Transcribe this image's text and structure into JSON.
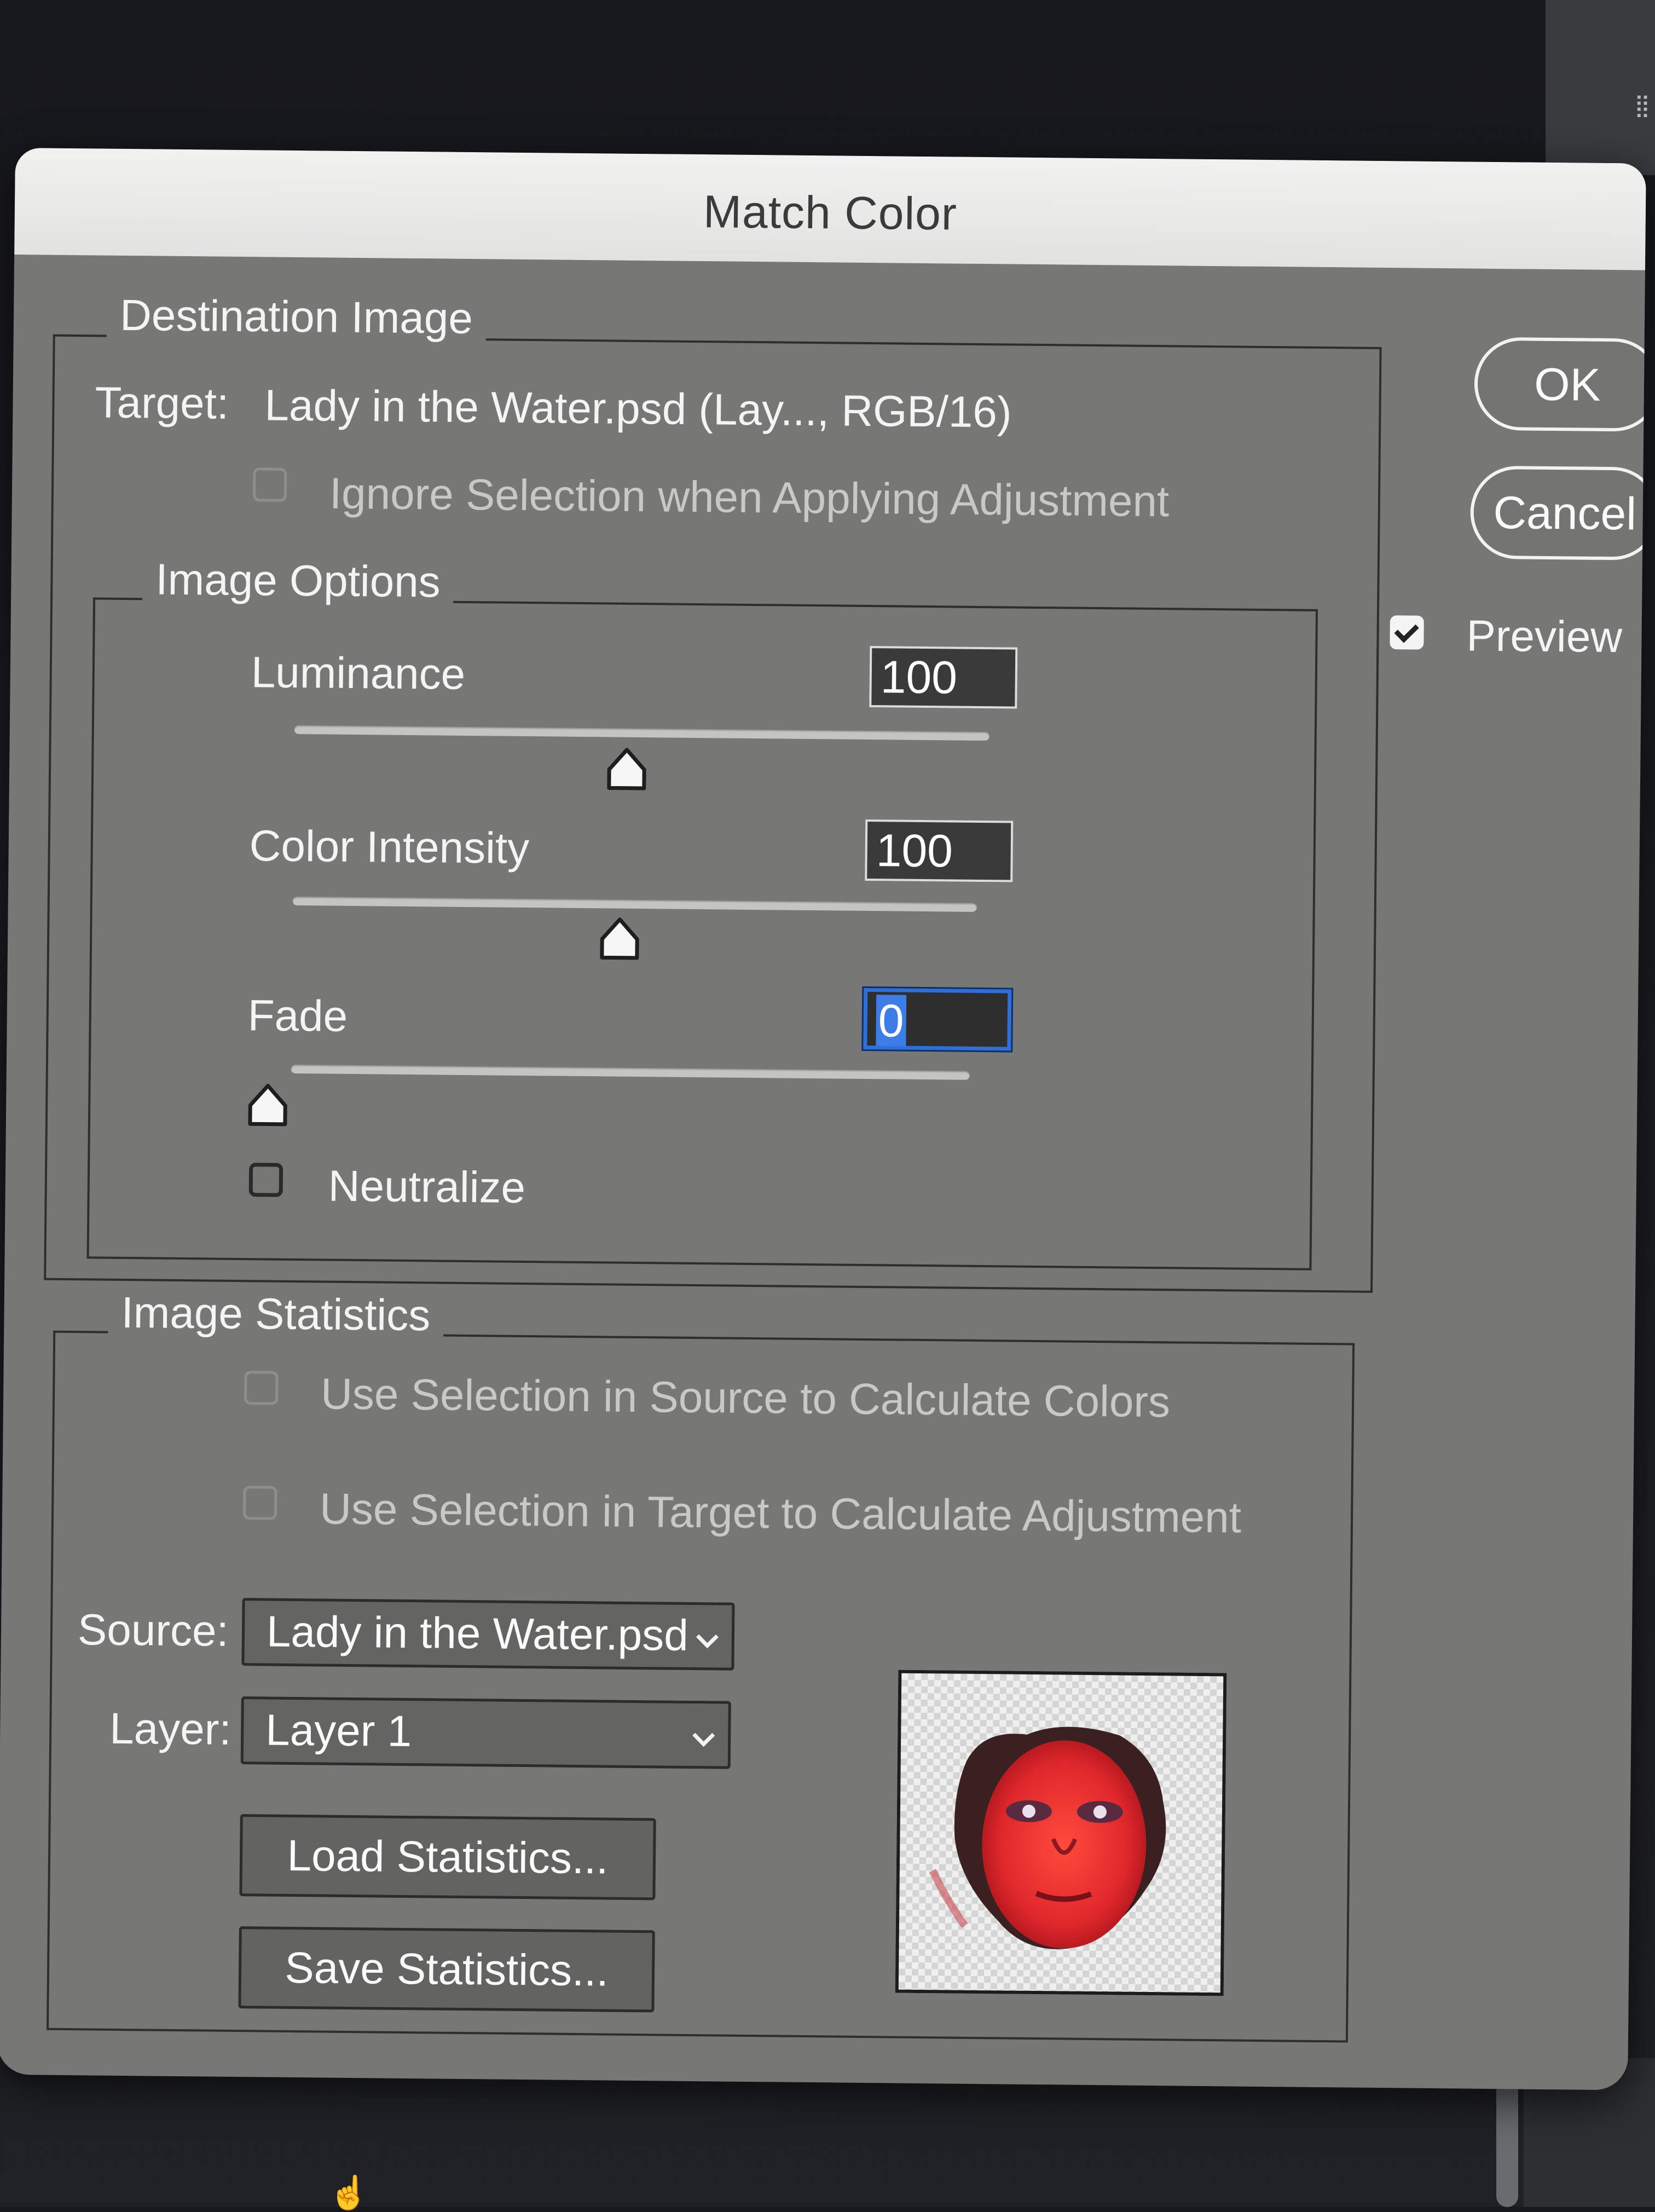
{
  "dialog": {
    "title": "Match Color",
    "ok_label": "OK",
    "cancel_label": "Cancel",
    "preview_label": "Preview",
    "preview_checked": true
  },
  "destination": {
    "legend": "Destination Image",
    "target_label": "Target:",
    "target_value": "Lady in the Water.psd (Lay..., RGB/16)",
    "ignore_selection_label": "Ignore Selection when Applying Adjustment",
    "ignore_selection_checked": false
  },
  "image_options": {
    "legend": "Image Options",
    "luminance_label": "Luminance",
    "luminance_value": "100",
    "color_intensity_label": "Color Intensity",
    "color_intensity_value": "100",
    "fade_label": "Fade",
    "fade_value": "0",
    "neutralize_label": "Neutralize",
    "neutralize_checked": false
  },
  "statistics": {
    "legend": "Image Statistics",
    "use_source_label": "Use Selection in Source to Calculate Colors",
    "use_target_label": "Use Selection in Target to Calculate Adjustment",
    "source_label": "Source:",
    "source_value": "Lady in the Water.psd",
    "layer_label": "Layer:",
    "layer_value": "Layer 1",
    "load_label": "Load Statistics...",
    "save_label": "Save Statistics..."
  },
  "colors": {
    "dialog_bg": "#777776",
    "titlebar_bg": "#e9e9e8",
    "focus_blue": "#2f6fd6"
  }
}
